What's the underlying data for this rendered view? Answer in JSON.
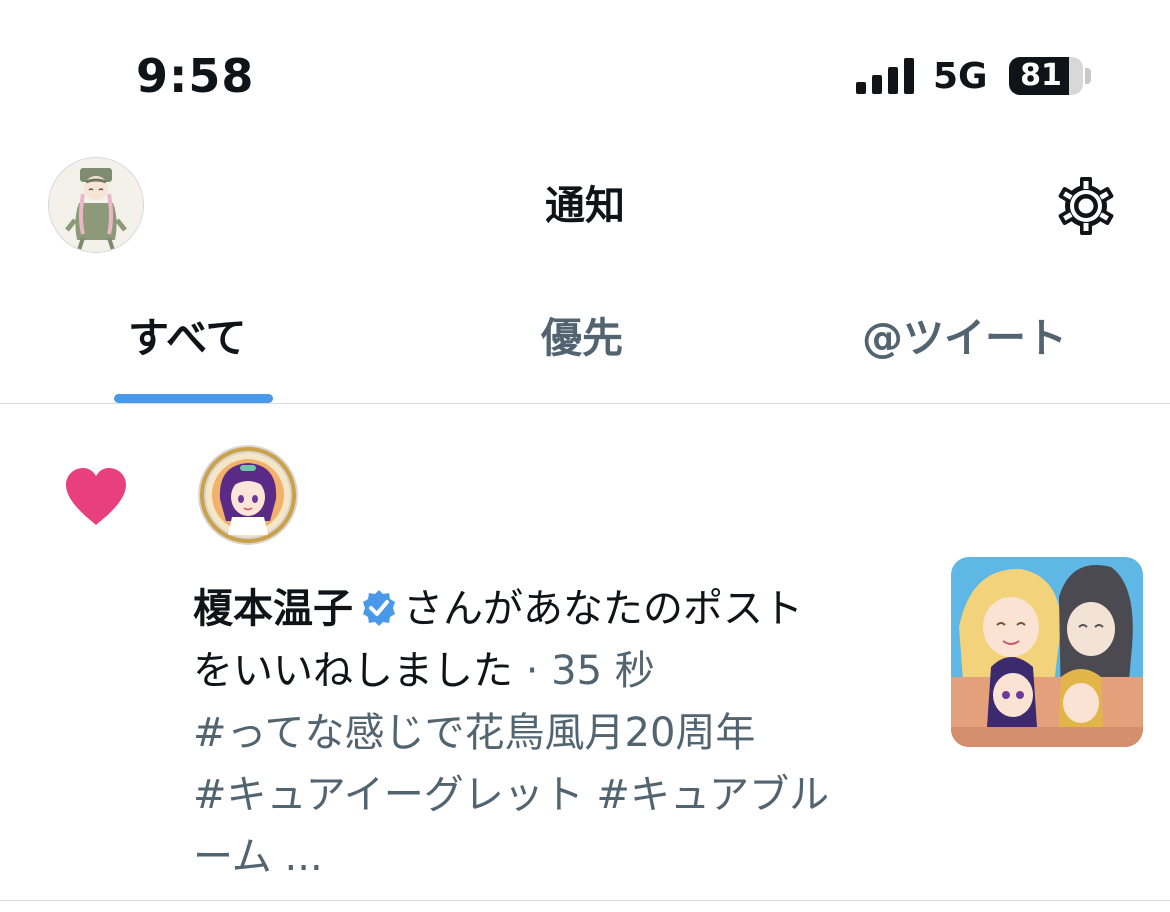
{
  "status_bar": {
    "time": "9:58",
    "network": "5G",
    "battery_percent": "81",
    "battery_level": 0.81
  },
  "header": {
    "title": "通知"
  },
  "tabs": [
    {
      "label": "すべて",
      "active": true
    },
    {
      "label": "優先",
      "active": false
    },
    {
      "label": "@ツイート",
      "active": false
    }
  ],
  "notification": {
    "icon": "heart-icon",
    "user_name": "榎本温子",
    "action_text_1": "さんがあなたのポスト",
    "action_text_2": "をいいねしました",
    "separator": " · ",
    "time": "35 秒",
    "post_text_1": "#ってな感じで花鳥風月20周年",
    "post_text_2": "#キュアイーグレット #キュアブル",
    "post_text_3": "ーム ..."
  },
  "colors": {
    "accent": "#4a99e9",
    "like": "#e8407e",
    "verified": "#4a99e9",
    "secondary_text": "#536471"
  }
}
